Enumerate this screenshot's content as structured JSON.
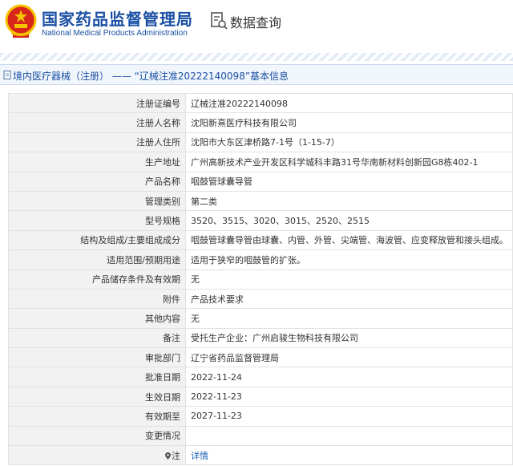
{
  "header": {
    "brand_cn": "国家药品监督管理局",
    "brand_en": "National Medical Products Administration",
    "page_title": "数据查询"
  },
  "crumb": {
    "text": "境内医疗器械（注册） —— “辽械注准20222140098”基本信息"
  },
  "details": [
    {
      "label": "注册证编号",
      "value": "辽械注准20222140098"
    },
    {
      "label": "注册人名称",
      "value": "沈阳新熹医疗科技有限公司"
    },
    {
      "label": "注册人住所",
      "value": "沈阳市大东区津桥路7-1号（1-15-7）"
    },
    {
      "label": "生产地址",
      "value": "广州高新技术产业开发区科学城科丰路31号华南新材料创新园G8栋402-1"
    },
    {
      "label": "产品名称",
      "value": "咽鼓管球囊导管"
    },
    {
      "label": "管理类别",
      "value": "第二类"
    },
    {
      "label": "型号规格",
      "value": "3520、3515、3020、3015、2520、2515"
    },
    {
      "label": "结构及组成/主要组成成分",
      "value": "咽鼓管球囊导管由球囊、内管、外管、尖端管、海波管、应变释放管和接头组成。"
    },
    {
      "label": "适用范围/预期用途",
      "value": "适用于狭窄的咽鼓管的扩张。"
    },
    {
      "label": "产品储存条件及有效期",
      "value": "无"
    },
    {
      "label": "附件",
      "value": "产品技术要求"
    },
    {
      "label": "其他内容",
      "value": "无"
    },
    {
      "label": "备注",
      "value": "受托生产企业：广州启骏生物科技有限公司"
    },
    {
      "label": "审批部门",
      "value": "辽宁省药品监督管理局"
    },
    {
      "label": "批准日期",
      "value": "2022-11-24"
    },
    {
      "label": "生效日期",
      "value": "2022-11-23"
    },
    {
      "label": "有效期至",
      "value": "2027-11-23"
    },
    {
      "label": "变更情况",
      "value": ""
    }
  ],
  "note": {
    "label": "注",
    "link": "详情"
  },
  "colors": {
    "brand": "#1a4fa3",
    "emblem_red": "#d8261b",
    "emblem_gold": "#f5c400",
    "link": "#1a5fb4"
  },
  "icons": {
    "emblem": "national-emblem-icon",
    "query": "document-search-icon",
    "crumb": "document-icon",
    "note": "map-pin-icon"
  }
}
